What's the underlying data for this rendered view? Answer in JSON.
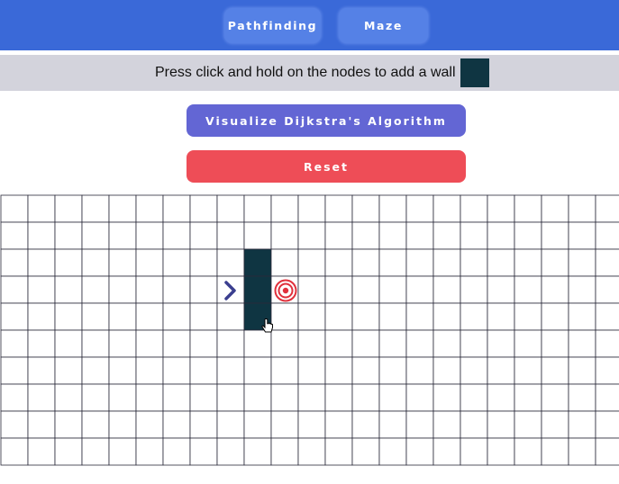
{
  "nav": {
    "pathfinding_label": "Pathfinding",
    "maze_label": "Maze"
  },
  "info": {
    "text": "Press click and hold on the nodes to add a wall",
    "wall_color": "#0f3542"
  },
  "actions": {
    "visualize_label": "Visualize Dijkstra's Algorithm",
    "reset_label": "Reset"
  },
  "grid": {
    "rows": 10,
    "cols": 23,
    "start_node": {
      "row": 3,
      "col": 8
    },
    "target_node": {
      "row": 3,
      "col": 10
    },
    "walls": [
      {
        "row": 2,
        "col": 9
      },
      {
        "row": 3,
        "col": 9
      },
      {
        "row": 4,
        "col": 9
      }
    ]
  },
  "colors": {
    "topbar": "#3a69d8",
    "wall": "#0f3542",
    "visualize_button": "#6366d4",
    "reset_button": "#ee4d57",
    "start_icon": "#3b3f8f",
    "target_icon": "#e0303c"
  }
}
